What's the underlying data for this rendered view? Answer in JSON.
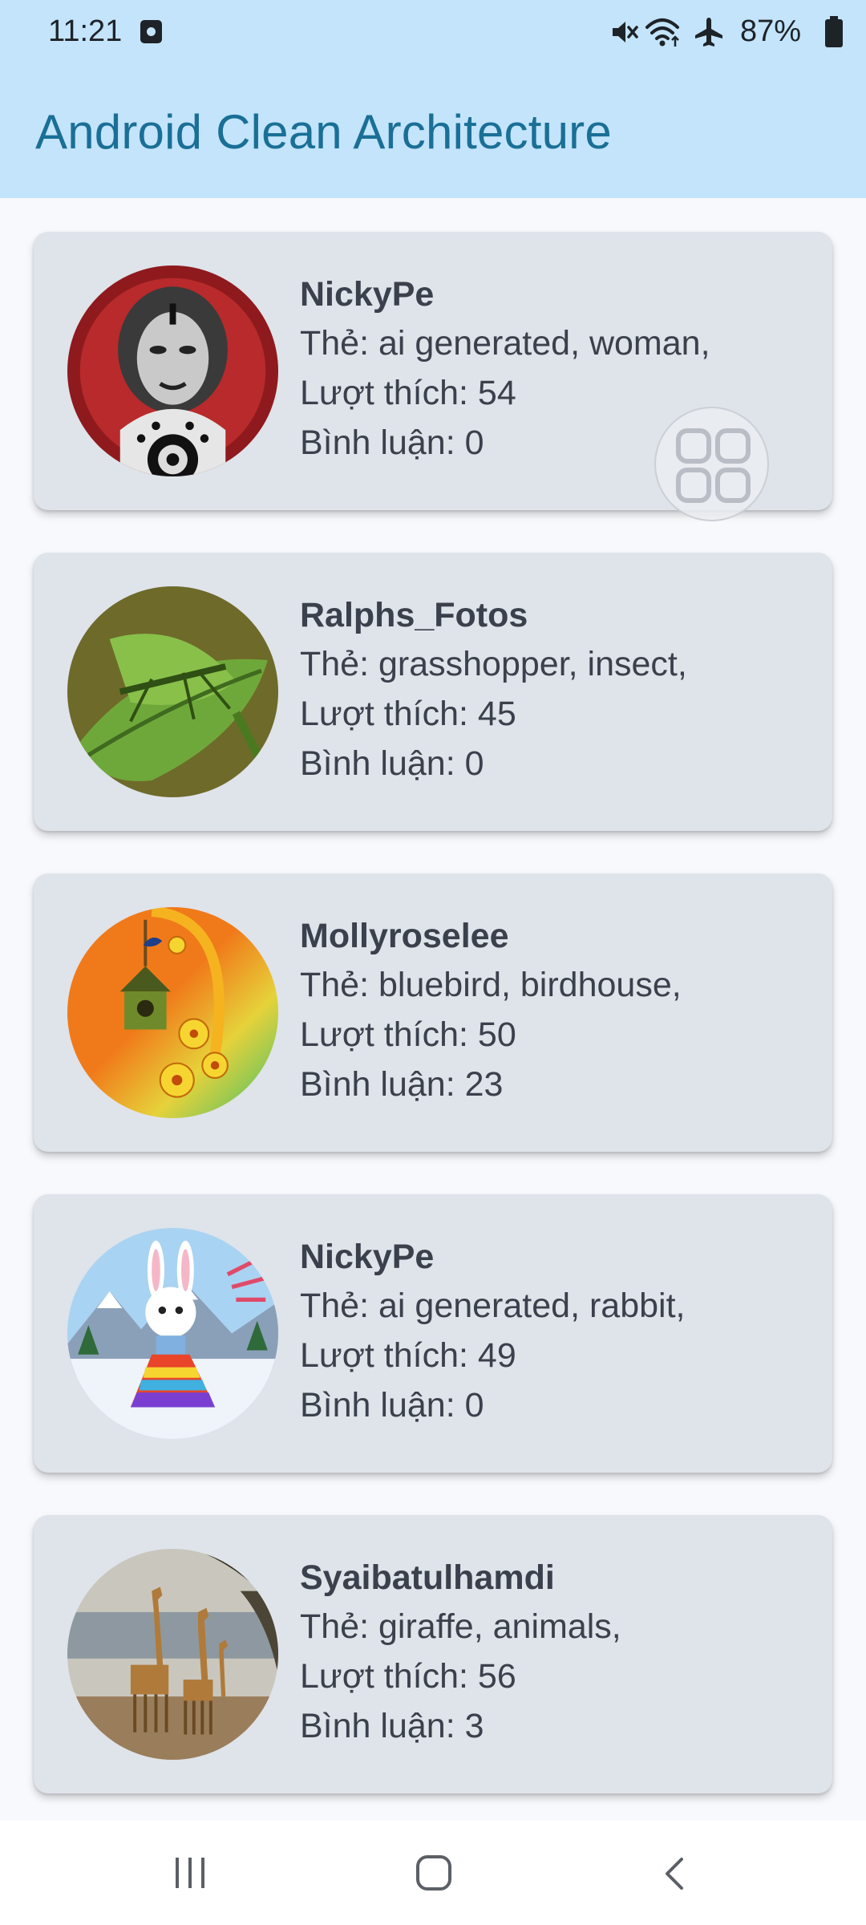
{
  "status_bar": {
    "time": "11:21",
    "battery_percent": "87%",
    "icons": [
      "screen-record-icon",
      "mute-icon",
      "wifi-icon",
      "airplane-mode-icon",
      "battery-icon"
    ]
  },
  "app_bar": {
    "title": "Android Clean Architecture"
  },
  "posts": [
    {
      "user": "NickyPe",
      "tags": "Thẻ: ai generated, woman,",
      "likes": "Lượt thích: 54",
      "comments": "Bình luận: 0"
    },
    {
      "user": "Ralphs_Fotos",
      "tags": "Thẻ: grasshopper, insect,",
      "likes": "Lượt thích: 45",
      "comments": "Bình luận: 0"
    },
    {
      "user": "Mollyroselee",
      "tags": "Thẻ: bluebird, birdhouse,",
      "likes": "Lượt thích: 50",
      "comments": "Bình luận: 23"
    },
    {
      "user": "NickyPe",
      "tags": "Thẻ: ai generated, rabbit,",
      "likes": "Lượt thích: 49",
      "comments": "Bình luận: 0"
    },
    {
      "user": "Syaibatulhamdi",
      "tags": "Thẻ: giraffe, animals,",
      "likes": "Lượt thích: 56",
      "comments": "Bình luận: 3"
    }
  ],
  "floating_button": {
    "icon": "grid-apps-icon"
  },
  "nav_bar": {
    "icons": [
      "recent-apps-icon",
      "home-icon",
      "back-icon"
    ]
  },
  "colors": {
    "app_bar": "#c3e4fb",
    "title": "#1a6f96",
    "card": "#dfe3ea",
    "background": "#f7f9fc"
  }
}
